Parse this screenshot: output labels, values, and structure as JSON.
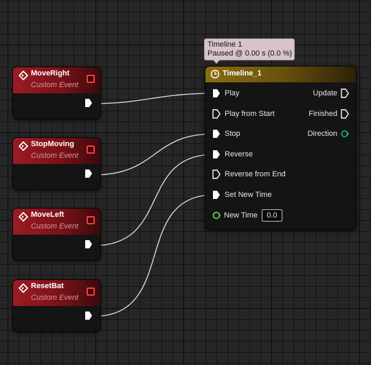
{
  "event_nodes": [
    {
      "title": "MoveRight",
      "subtitle": "Custom Event"
    },
    {
      "title": "StopMoving",
      "subtitle": "Custom Event"
    },
    {
      "title": "MoveLeft",
      "subtitle": "Custom Event"
    },
    {
      "title": "ResetBat",
      "subtitle": "Custom Event"
    }
  ],
  "tooltip": {
    "line1": "Timeline 1",
    "line2": "Paused @ 0.00 s (0.0 %)"
  },
  "timeline_node": {
    "title": "Timeline_1",
    "inputs": [
      "Play",
      "Play from Start",
      "Stop",
      "Reverse",
      "Reverse from End",
      "Set New Time"
    ],
    "outputs": [
      "Update",
      "Finished",
      "Direction"
    ],
    "new_time_label": "New Time",
    "new_time_value": "0.0"
  },
  "colors": {
    "event_header": "#9c1b24",
    "timeline_header": "#8a6d12",
    "wire": "#e6e6e6",
    "direction_pin": "#1fb39a",
    "new_time_pin": "#6ee05a",
    "delegate_pin": "#ff3b3b"
  },
  "icons": {
    "event": "event-diamond-icon",
    "timeline": "clock-icon",
    "exec": "exec-pin-icon",
    "data": "data-pin-icon"
  }
}
